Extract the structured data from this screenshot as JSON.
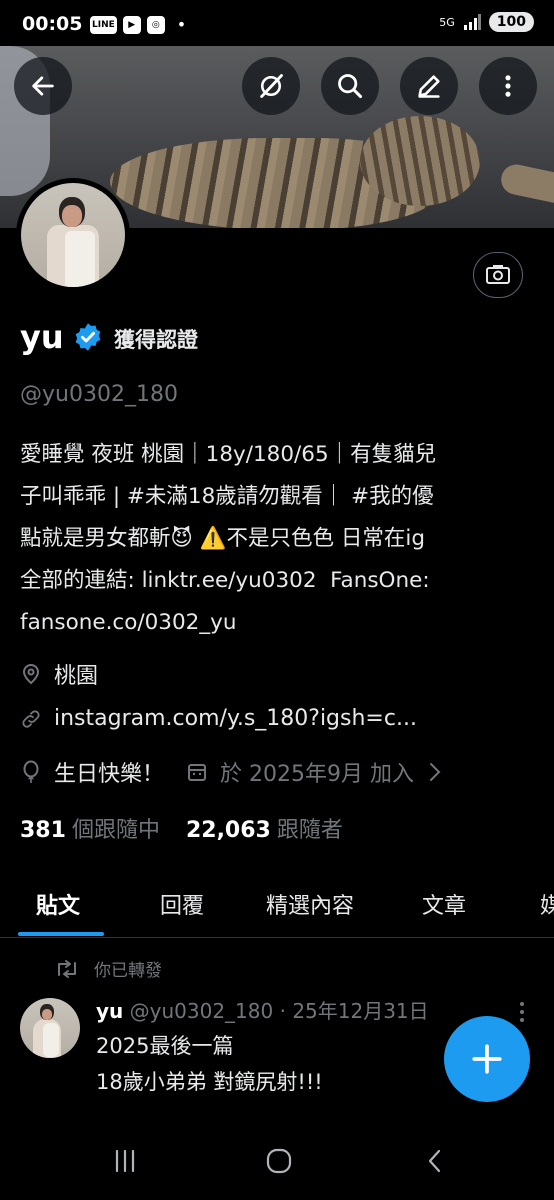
{
  "status_bar": {
    "time": "00:05",
    "app_icons": [
      "LINE",
      "▶",
      "◎"
    ],
    "dot": "•",
    "signal": "5G",
    "battery": "100"
  },
  "profile": {
    "name": "yu",
    "verify_link": "獲得認證",
    "handle": "@yu0302_180",
    "bio": "愛睡覺 夜班 桃園｜18y/180/65｜有隻貓兒\n子叫乖乖 | #未滿18歲請勿觀看｜ #我的優\n點就是男女都斬😈 ⚠️不是只色色 日常在ig\n全部的連結: linktr.ee/yu0302  FansOne:\nfansone.co/0302_yu",
    "location": "桃園",
    "website": "instagram.com/y.s_180?igsh=c...",
    "birthday": "生日快樂！",
    "joined": "於 2025年9月 加入",
    "following_count": "381",
    "following_label": "個跟隨中",
    "followers_count": "22,063",
    "followers_label": "跟隨者"
  },
  "tabs": [
    {
      "label": "貼文"
    },
    {
      "label": "回覆"
    },
    {
      "label": "精選內容"
    },
    {
      "label": "文章"
    },
    {
      "label": "媒"
    }
  ],
  "post": {
    "repost_label": "你已轉發",
    "author_name": "yu",
    "author_handle": "@yu0302_180",
    "separator": "·",
    "date": "25年12月31日",
    "text": "2025最後一篇\n18歲小弟弟 對鏡尻射!!!"
  },
  "colors": {
    "accent": "#1d9bf0",
    "muted": "#71767b",
    "background": "#000000"
  }
}
